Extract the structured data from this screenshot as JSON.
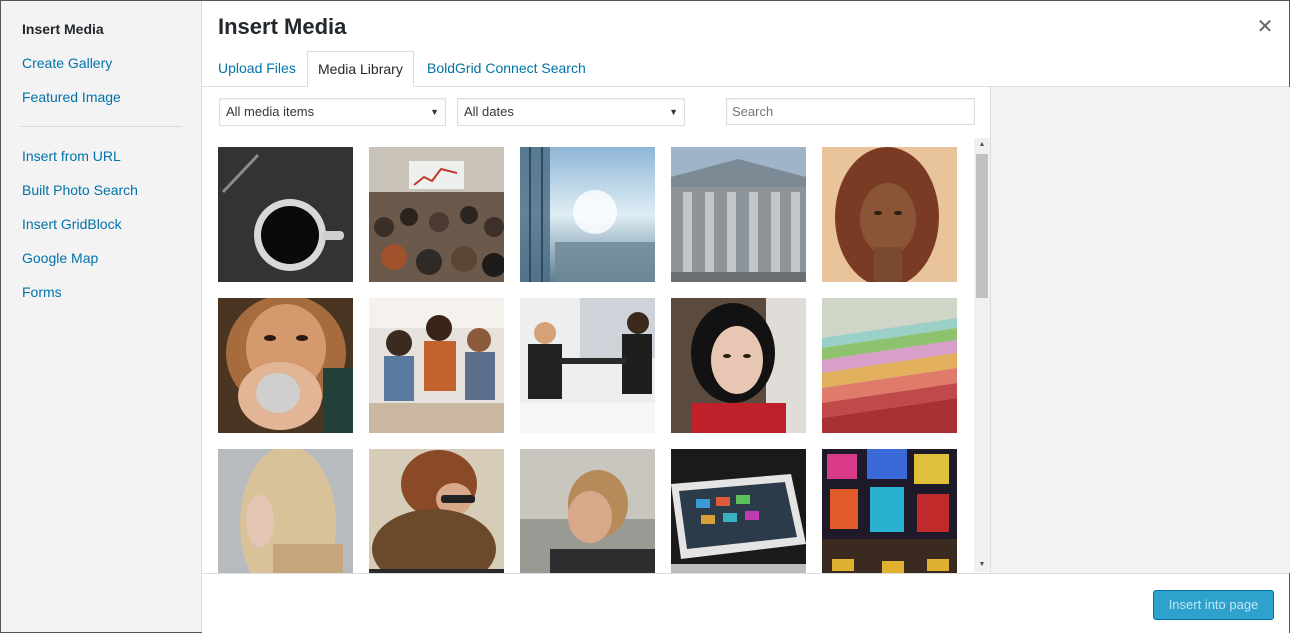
{
  "sidebar": {
    "items": [
      {
        "label": "Insert Media",
        "active": true
      },
      {
        "label": "Create Gallery"
      },
      {
        "label": "Featured Image"
      },
      {
        "label": "Insert from URL"
      },
      {
        "label": "Built Photo Search"
      },
      {
        "label": "Insert GridBlock"
      },
      {
        "label": "Google Map"
      },
      {
        "label": "Forms"
      }
    ]
  },
  "header": {
    "title": "Insert Media",
    "close_icon": "close-icon"
  },
  "tabs": [
    {
      "label": "Upload Files"
    },
    {
      "label": "Media Library",
      "active": true
    },
    {
      "label": "BoldGrid Connect Search"
    }
  ],
  "toolbar": {
    "type_filter": "All media items",
    "date_filter": "All dates",
    "search_placeholder": "Search"
  },
  "media": [
    {
      "subject": "coffee cup on dark desk"
    },
    {
      "subject": "conference audience"
    },
    {
      "subject": "city view from glass building"
    },
    {
      "subject": "columned building facade"
    },
    {
      "subject": "woman portrait"
    },
    {
      "subject": "woman holding mug"
    },
    {
      "subject": "team meeting at desk"
    },
    {
      "subject": "business handshake"
    },
    {
      "subject": "dark-haired woman portrait"
    },
    {
      "subject": "colored paper stack"
    },
    {
      "subject": "blonde woman profile"
    },
    {
      "subject": "man with sunglasses and scarf"
    },
    {
      "subject": "man looking away"
    },
    {
      "subject": "tablet on laptop"
    },
    {
      "subject": "city billboards at night"
    }
  ],
  "footer": {
    "insert_label": "Insert into page"
  },
  "colors": {
    "link": "#0073aa",
    "button": "#2ea2cc",
    "sidebar_bg": "#f3f3f3"
  }
}
